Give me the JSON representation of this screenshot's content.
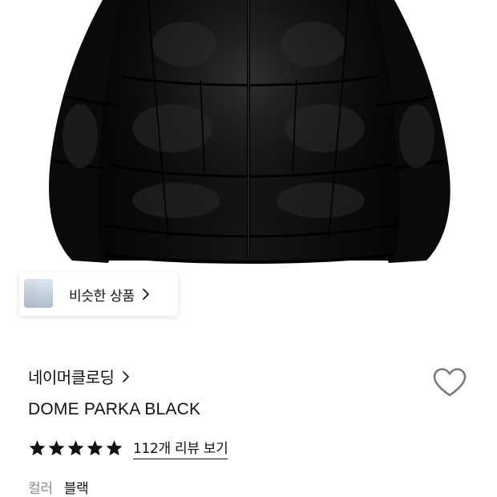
{
  "similar": {
    "label": "비슷한 상품"
  },
  "brand": {
    "name": "네이머클로딩"
  },
  "product": {
    "title": "DOME PARKA BLACK",
    "rating": 5,
    "review_link": "112개 리뷰 보기",
    "color_label": "컬러",
    "color_value": "블랙"
  },
  "icons": {
    "chip_chevron": "chevron-right-icon",
    "brand_chevron": "chevron-right-icon",
    "wishlist": "heart-outline-icon",
    "star": "star-icon"
  },
  "colors": {
    "jacket": "#0d0d0d",
    "text": "#111111",
    "muted": "#8a8a8a",
    "heart_outline": "#7a7a7a"
  }
}
